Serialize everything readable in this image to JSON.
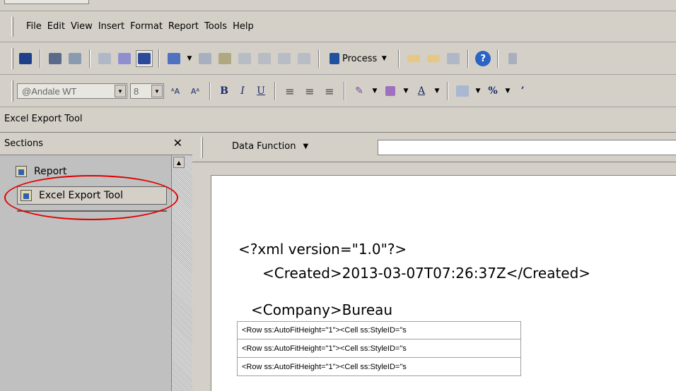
{
  "menu": {
    "items": [
      "File",
      "Edit",
      "View",
      "Insert",
      "Format",
      "Report",
      "Tools",
      "Help"
    ]
  },
  "toolbar": {
    "process_label": "Process"
  },
  "format_bar": {
    "font": "@Andale WT",
    "size": "8",
    "bold": "B",
    "italic": "I",
    "underline": "U",
    "percent": "%",
    "comma": "’"
  },
  "window": {
    "title": "Excel Export Tool"
  },
  "sections": {
    "header": "Sections",
    "close": "✕",
    "items": [
      {
        "label": "Report"
      },
      {
        "label": "Excel Export Tool"
      }
    ]
  },
  "content": {
    "data_function": "Data Function",
    "lines": [
      "<?xml version=\"1.0\"?>",
      "<Created>2013-03-07T07:26:37Z</Created>",
      "<Company>Bureau"
    ],
    "rows": [
      "<Row ss:AutoFitHeight=\"1\"><Cell ss:StyleID=\"s",
      "<Row ss:AutoFitHeight=\"1\"><Cell ss:StyleID=\"s",
      "<Row ss:AutoFitHeight=\"1\"><Cell ss:StyleID=\"s"
    ]
  },
  "colors": {
    "highlight_ring": "#e00000",
    "help_icon": "#2a64c4"
  }
}
